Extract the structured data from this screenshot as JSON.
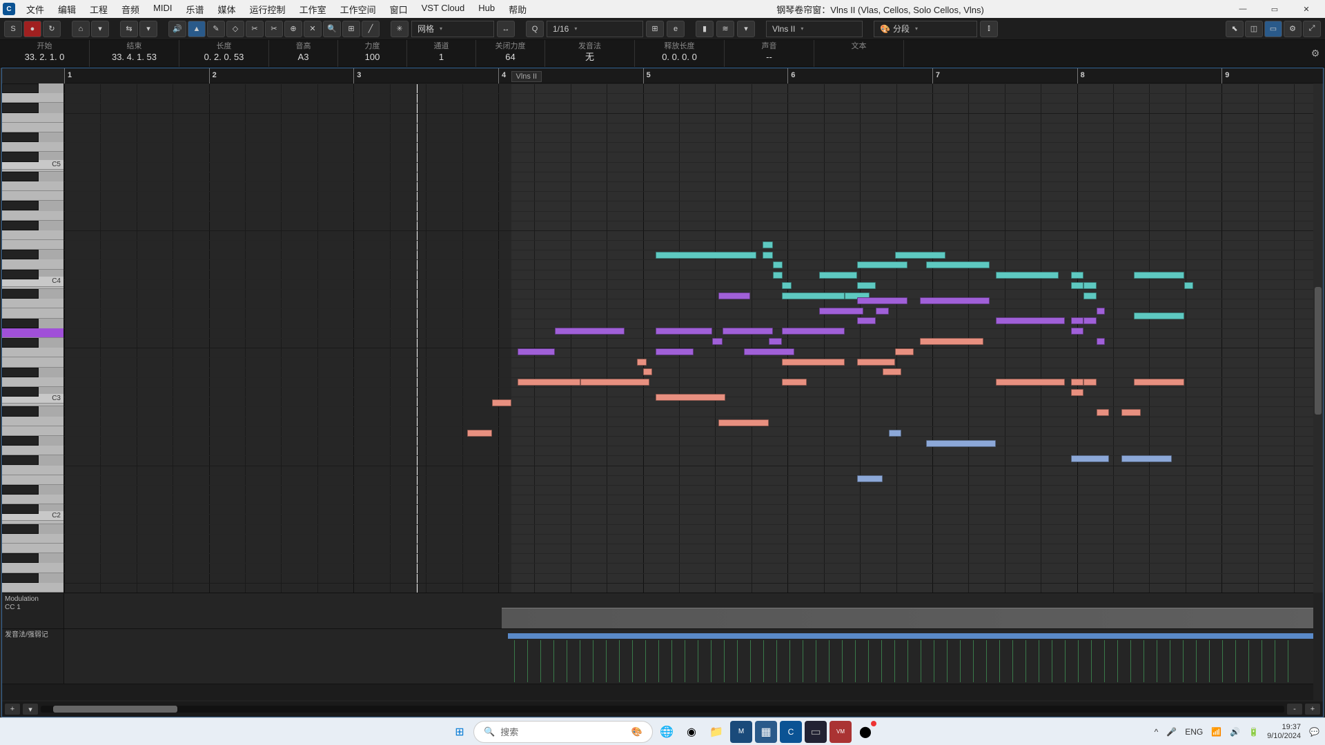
{
  "title": "钢琴卷帘窗：Vlns II  (Vlas, Cellos, Solo Cellos, Vlns)",
  "menu": [
    "文件",
    "编辑",
    "工程",
    "音频",
    "MIDI",
    "乐谱",
    "媒体",
    "运行控制",
    "工作室",
    "工作空间",
    "窗口",
    "VST Cloud",
    "Hub",
    "帮助"
  ],
  "toolbar": {
    "snap_mode": "网格",
    "quantize": "1/16",
    "part_selector": "Vlns II",
    "color_mode": "分段"
  },
  "info": [
    {
      "label": "开始",
      "value": "33. 2. 1.  0",
      "wide": true
    },
    {
      "label": "结束",
      "value": "33. 4. 1. 53",
      "wide": true
    },
    {
      "label": "长度",
      "value": "0. 2. 0. 53",
      "wide": true
    },
    {
      "label": "音高",
      "value": "A3",
      "wide": false
    },
    {
      "label": "力度",
      "value": "100",
      "wide": false
    },
    {
      "label": "通道",
      "value": "1",
      "wide": false
    },
    {
      "label": "关闭力度",
      "value": "64",
      "wide": false
    },
    {
      "label": "发音法",
      "value": "无",
      "wide": true
    },
    {
      "label": "释放长度",
      "value": "0. 0. 0.  0",
      "wide": true
    },
    {
      "label": "声音",
      "value": "--",
      "wide": true
    },
    {
      "label": "文本",
      "value": "",
      "wide": true
    }
  ],
  "ruler": {
    "bars": [
      1,
      2,
      3,
      4,
      5,
      6,
      7,
      8,
      9
    ],
    "part_label": "Vlns II"
  },
  "octaves": [
    "C5",
    "C4",
    "C3",
    "C2"
  ],
  "lanes": {
    "cc": "Modulation\nCC 1",
    "art": "发音法/强弱记"
  },
  "notes_teal": [
    {
      "l": 47,
      "t": 33,
      "w": 8
    },
    {
      "l": 55.5,
      "t": 33,
      "w": 0.8
    },
    {
      "l": 55.5,
      "t": 31,
      "w": 0.8
    },
    {
      "l": 56.3,
      "t": 35,
      "w": 0.8
    },
    {
      "l": 56.3,
      "t": 37,
      "w": 0.8
    },
    {
      "l": 57,
      "t": 39,
      "w": 0.8
    },
    {
      "l": 57,
      "t": 41,
      "w": 5
    },
    {
      "l": 60,
      "t": 37,
      "w": 3
    },
    {
      "l": 63,
      "t": 39,
      "w": 1.5
    },
    {
      "l": 63,
      "t": 35,
      "w": 4
    },
    {
      "l": 62,
      "t": 41,
      "w": 2
    },
    {
      "l": 66,
      "t": 33,
      "w": 4
    },
    {
      "l": 68.5,
      "t": 35,
      "w": 5
    },
    {
      "l": 74,
      "t": 37,
      "w": 5
    },
    {
      "l": 80,
      "t": 39,
      "w": 1
    },
    {
      "l": 80,
      "t": 37,
      "w": 1
    },
    {
      "l": 81,
      "t": 39,
      "w": 1
    },
    {
      "l": 81,
      "t": 41,
      "w": 1
    },
    {
      "l": 85,
      "t": 37,
      "w": 4
    },
    {
      "l": 85,
      "t": 45,
      "w": 4
    },
    {
      "l": 89,
      "t": 39,
      "w": 0.7
    }
  ],
  "notes_purple": [
    {
      "l": 36,
      "t": 52,
      "w": 3
    },
    {
      "l": 39,
      "t": 48,
      "w": 5.5
    },
    {
      "l": 47,
      "t": 52,
      "w": 3
    },
    {
      "l": 47,
      "t": 48,
      "w": 4.5
    },
    {
      "l": 51.5,
      "t": 50,
      "w": 0.8
    },
    {
      "l": 52.3,
      "t": 48,
      "w": 4
    },
    {
      "l": 52,
      "t": 41,
      "w": 2.5
    },
    {
      "l": 54,
      "t": 52,
      "w": 4
    },
    {
      "l": 56,
      "t": 50,
      "w": 1
    },
    {
      "l": 57,
      "t": 48,
      "w": 5
    },
    {
      "l": 60,
      "t": 44,
      "w": 3.5
    },
    {
      "l": 63,
      "t": 46,
      "w": 1.5
    },
    {
      "l": 63,
      "t": 42,
      "w": 4
    },
    {
      "l": 64.5,
      "t": 44,
      "w": 1
    },
    {
      "l": 68,
      "t": 42,
      "w": 5.5
    },
    {
      "l": 74,
      "t": 46,
      "w": 5.5
    },
    {
      "l": 80,
      "t": 48,
      "w": 1
    },
    {
      "l": 80,
      "t": 46,
      "w": 1
    },
    {
      "l": 81,
      "t": 46,
      "w": 1
    },
    {
      "l": 82,
      "t": 44,
      "w": 0.7
    },
    {
      "l": 82,
      "t": 50,
      "w": 0.7
    }
  ],
  "notes_salmon": [
    {
      "l": 32,
      "t": 68,
      "w": 2
    },
    {
      "l": 34,
      "t": 62,
      "w": 1.5
    },
    {
      "l": 36,
      "t": 58,
      "w": 5
    },
    {
      "l": 41,
      "t": 58,
      "w": 5.5
    },
    {
      "l": 47,
      "t": 61,
      "w": 5.5
    },
    {
      "l": 52,
      "t": 66,
      "w": 4
    },
    {
      "l": 45.5,
      "t": 54,
      "w": 0.8
    },
    {
      "l": 46,
      "t": 56,
      "w": 0.7
    },
    {
      "l": 57,
      "t": 54,
      "w": 5
    },
    {
      "l": 57,
      "t": 58,
      "w": 2
    },
    {
      "l": 63,
      "t": 54,
      "w": 3
    },
    {
      "l": 65,
      "t": 56,
      "w": 1.5
    },
    {
      "l": 66,
      "t": 52,
      "w": 1.5
    },
    {
      "l": 68,
      "t": 50,
      "w": 5
    },
    {
      "l": 74,
      "t": 58,
      "w": 5.5
    },
    {
      "l": 80,
      "t": 58,
      "w": 1
    },
    {
      "l": 80,
      "t": 60,
      "w": 1
    },
    {
      "l": 81,
      "t": 58,
      "w": 1
    },
    {
      "l": 82,
      "t": 64,
      "w": 1
    },
    {
      "l": 84,
      "t": 64,
      "w": 1.5
    },
    {
      "l": 85,
      "t": 58,
      "w": 4
    }
  ],
  "notes_blue": [
    {
      "l": 65.5,
      "t": 68,
      "w": 1
    },
    {
      "l": 68.5,
      "t": 70,
      "w": 5.5
    },
    {
      "l": 63,
      "t": 77,
      "w": 2
    },
    {
      "l": 80,
      "t": 73,
      "w": 3
    },
    {
      "l": 84,
      "t": 73,
      "w": 4
    }
  ],
  "taskbar": {
    "search_placeholder": "搜索",
    "lang": "ENG",
    "time": "19:37",
    "date": "9/10/2024"
  }
}
